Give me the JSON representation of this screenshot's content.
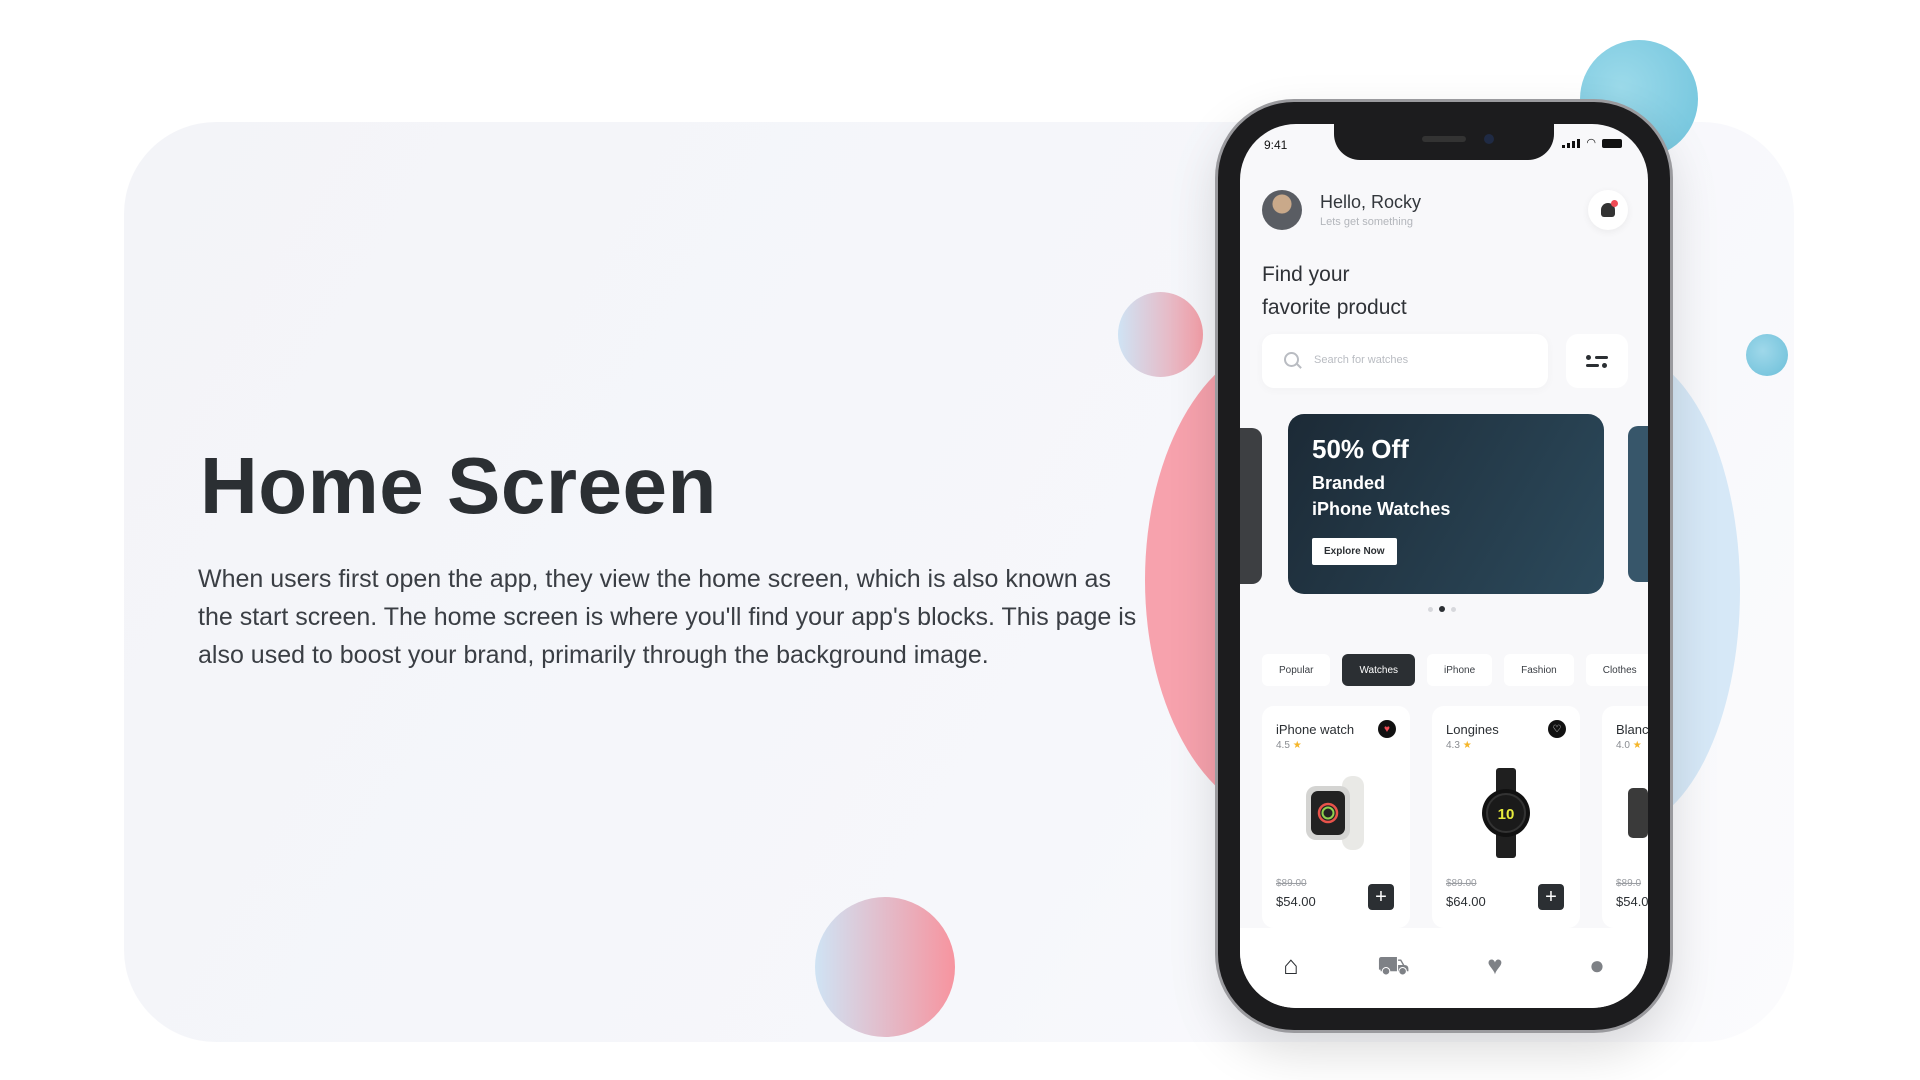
{
  "slide": {
    "title": "Home Screen",
    "description": "When users first open the app, they view the home screen, which is also known as the start screen. The home screen is where you'll find your app's blocks. This page is also used to boost your brand, primarily through the background image."
  },
  "status_bar": {
    "time": "9:41"
  },
  "header": {
    "greeting": "Hello, Rocky",
    "subtitle": "Lets get something"
  },
  "headline": {
    "line1": "Find your",
    "line2": "favorite product"
  },
  "search": {
    "placeholder": "Search for watches"
  },
  "banner": {
    "discount": "50% Off",
    "line1": "Branded",
    "line2": "iPhone Watches",
    "button": "Explore Now"
  },
  "categories": [
    "Popular",
    "Watches",
    "iPhone",
    "Fashion",
    "Clothes"
  ],
  "active_category": "Watches",
  "products": [
    {
      "name": "iPhone watch",
      "rating": "4.5",
      "old_price": "$89.00",
      "price": "$54.00"
    },
    {
      "name": "Longines",
      "rating": "4.3",
      "old_price": "$89.00",
      "price": "$64.00",
      "watch_face": "10"
    },
    {
      "name": "Blanc",
      "rating": "4.0",
      "old_price": "$89.0",
      "price": "$54.0"
    }
  ],
  "colors": {
    "accent": "#2b2f33",
    "banner_start": "#1c2a36",
    "banner_end": "#2c4a5c",
    "heart": "#ef4b55"
  },
  "icons": [
    "search-icon",
    "filter-icon",
    "bell-icon",
    "heart-icon",
    "plus-icon",
    "home-icon",
    "cart-icon",
    "favorites-icon",
    "profile-icon"
  ]
}
